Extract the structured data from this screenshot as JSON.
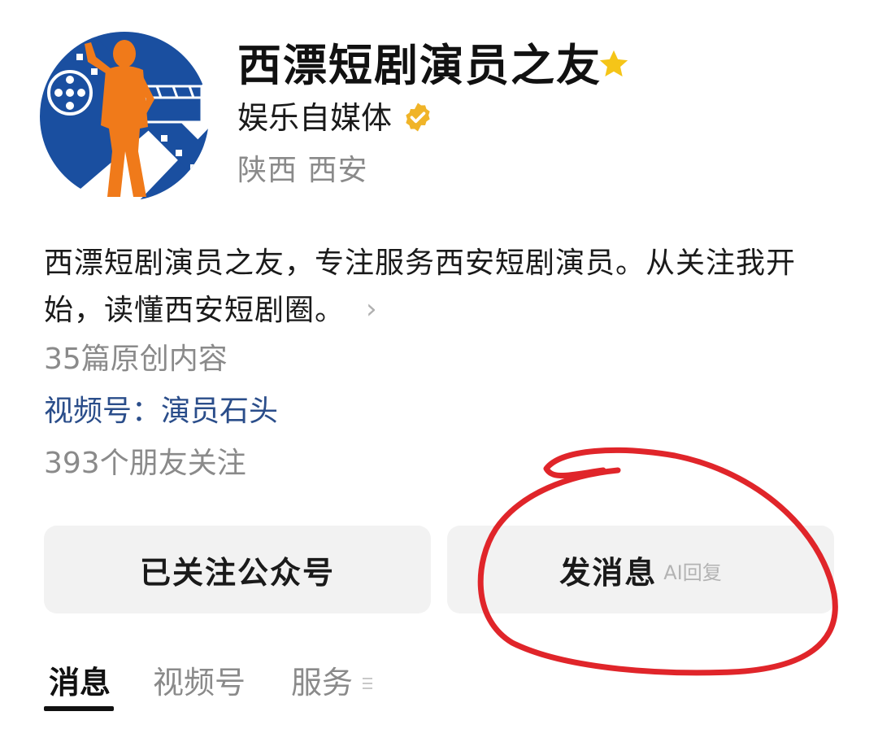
{
  "profile": {
    "name": "西漂短剧演员之友",
    "account_type": "娱乐自媒体",
    "location": "陕西 西安",
    "description": "西漂短剧演员之友，专注服务西安短剧演员。从关注我开始，读懂西安短剧圈。",
    "original_count": "35篇原创内容",
    "channels_label": "视频号：演员石头",
    "friends_follow": "393个朋友关注",
    "icons": [
      "avatar-logo",
      "star-icon",
      "verified-icon",
      "chevron-right-icon"
    ]
  },
  "actions": {
    "followed_label": "已关注公众号",
    "message_label": "发消息",
    "ai_reply_tag": "AI回复"
  },
  "tabs": [
    {
      "label": "消息",
      "active": true
    },
    {
      "label": "视频号",
      "active": false
    },
    {
      "label": "服务",
      "active": false
    }
  ],
  "colors": {
    "star": "#f5c518",
    "verified": "#f0b428",
    "link": "#2a4d8a",
    "annotation": "#e0252a",
    "avatar_blue": "#1a4fa0",
    "avatar_orange": "#f07a1a"
  }
}
